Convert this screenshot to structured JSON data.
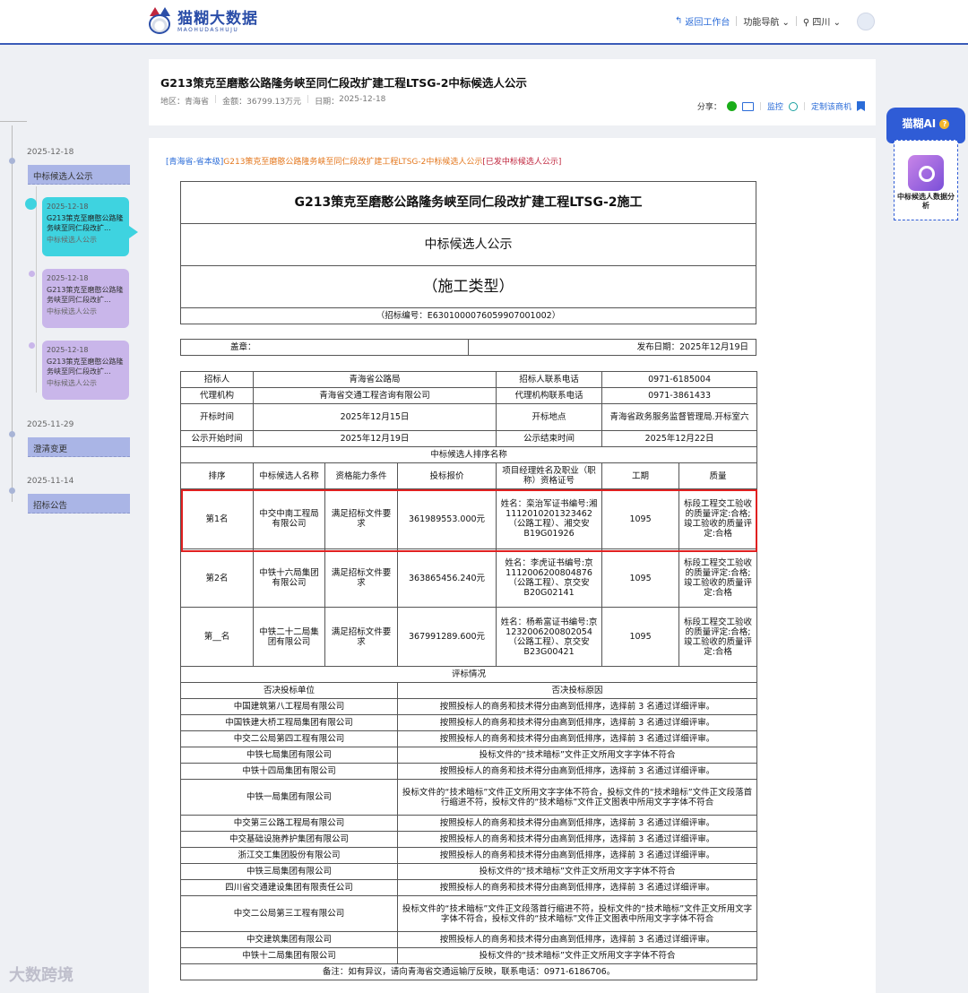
{
  "brand": {
    "name_cn": "猫糊大数据",
    "name_en": "MAOHUDASHUJU"
  },
  "nav": {
    "back": "返回工作台",
    "func_nav": "功能导航",
    "region": "四川"
  },
  "header": {
    "title": "G213策克至磨憨公路隆务峡至同仁段改扩建工程LTSG-2中标候选人公示",
    "region_label": "地区：",
    "region": "青海省",
    "amount_label": "金额：",
    "amount": "36799.13万元",
    "date_label": "日期：",
    "date": "2025-12-18",
    "share": "分享：",
    "monitor": "监控",
    "subscribe": "定制该商机"
  },
  "timeline": {
    "d1": "2025-12-18",
    "t1": "中标候选人公示",
    "c1_date": "2025-12-18",
    "c1_title": "G213策克至磨憨公路隆务峡至同仁段改扩...",
    "c1_type": "中标候选人公示",
    "c2_date": "2025-12-18",
    "c2_title": "G213策克至磨憨公路隆务峡至同仁段改扩...",
    "c2_type": "中标候选人公示",
    "c3_date": "2025-12-18",
    "c3_title": "G213策克至磨憨公路隆务峡至同仁段改扩...",
    "c3_type": "中标候选人公示",
    "d2": "2025-11-29",
    "t2": "澄清变更",
    "d3": "2025-11-14",
    "t3": "招标公告"
  },
  "doc": {
    "src_prefix": "[青海省-省本级]",
    "src_title": "G213策克至磨憨公路隆务峡至同仁段改扩建工程LTSG-2中标候选人公示",
    "src_suffix": "[已发中标候选人公示]",
    "h1": "G213策克至磨憨公路隆务峡至同仁段改扩建工程LTSG-2施工",
    "h2": "中标候选人公示",
    "h3": "（施工类型）",
    "code": "（招标编号：E6301000076059907001002）",
    "seal": "盖章：",
    "publish": "发布日期：2025年12月19日"
  },
  "info": {
    "tenderer_l": "招标人",
    "tenderer": "青海省公路局",
    "tenderer_tel_l": "招标人联系电话",
    "tenderer_tel": "0971-6185004",
    "agent_l": "代理机构",
    "agent": "青海省交通工程咨询有限公司",
    "agent_tel_l": "代理机构联系电话",
    "agent_tel": "0971-3861433",
    "open_time_l": "开标时间",
    "open_time": "2025年12月15日",
    "open_place_l": "开标地点",
    "open_place": "青海省政务服务监督管理局.开标室六",
    "pub_start_l": "公示开始时间",
    "pub_start": "2025年12月19日",
    "pub_end_l": "公示结束时间",
    "pub_end": "2025年12月22日"
  },
  "rank": {
    "section": "中标候选人排序名称",
    "headers": [
      "排序",
      "中标候选人名称",
      "资格能力条件",
      "投标报价",
      "项目经理姓名及职业（职称）资格证号",
      "工期",
      "质量"
    ],
    "rows": [
      {
        "rank": "第1名",
        "name": "中交中南工程局有限公司",
        "cond": "满足招标文件要求",
        "price": "361989553.000元",
        "pm": "姓名：栾治军证书编号:湘1112010201323462（公路工程）、湘交安B19G01926",
        "period": "1095",
        "quality": "标段工程交工验收的质量评定:合格; 竣工验收的质量评定:合格"
      },
      {
        "rank": "第2名",
        "name": "中铁十六局集团有限公司",
        "cond": "满足招标文件要求",
        "price": "363865456.240元",
        "pm": "姓名：李虎证书编号:京1112006200804876（公路工程）、京交安B20G02141",
        "period": "1095",
        "quality": "标段工程交工验收的质量评定:合格; 竣工验收的质量评定:合格"
      },
      {
        "rank": "第__名",
        "name": "中铁二十二局集团有限公司",
        "cond": "满足招标文件要求",
        "price": "367991289.600元",
        "pm": "姓名：杨希富证书编号:京1232006200802054（公路工程）、京交安B23G00421",
        "period": "1095",
        "quality": "标段工程交工验收的质量评定:合格; 竣工验收的质量评定:合格"
      }
    ]
  },
  "review": {
    "section": "评标情况",
    "col1": "否决投标单位",
    "col2": "否决投标原因",
    "rows": [
      {
        "unit": "中国建筑第八工程局有限公司",
        "reason": "按照投标人的商务和技术得分由高到低排序，选择前 3 名通过详细评审。"
      },
      {
        "unit": "中国铁建大桥工程局集团有限公司",
        "reason": "按照投标人的商务和技术得分由高到低排序，选择前 3 名通过详细评审。"
      },
      {
        "unit": "中交二公局第四工程有限公司",
        "reason": "按照投标人的商务和技术得分由高到低排序，选择前 3 名通过详细评审。"
      },
      {
        "unit": "中铁七局集团有限公司",
        "reason": "投标文件的“技术暗标”文件正文所用文字字体不符合"
      },
      {
        "unit": "中铁十四局集团有限公司",
        "reason": "按照投标人的商务和技术得分由高到低排序，选择前 3 名通过详细评审。"
      },
      {
        "unit": "中铁一局集团有限公司",
        "reason": "投标文件的“技术暗标”文件正文所用文字字体不符合，投标文件的“技术暗标”文件正文段落首行缩进不符，投标文件的“技术暗标”文件正文图表中所用文字字体不符合"
      },
      {
        "unit": "中交第三公路工程局有限公司",
        "reason": "按照投标人的商务和技术得分由高到低排序，选择前 3 名通过详细评审。"
      },
      {
        "unit": "中交基础设施养护集团有限公司",
        "reason": "按照投标人的商务和技术得分由高到低排序，选择前 3 名通过详细评审。"
      },
      {
        "unit": "浙江交工集团股份有限公司",
        "reason": "按照投标人的商务和技术得分由高到低排序，选择前 3 名通过详细评审。"
      },
      {
        "unit": "中铁三局集团有限公司",
        "reason": "投标文件的“技术暗标”文件正文所用文字字体不符合"
      },
      {
        "unit": "四川省交通建设集团有限责任公司",
        "reason": "按照投标人的商务和技术得分由高到低排序，选择前 3 名通过详细评审。"
      },
      {
        "unit": "中交二公局第三工程有限公司",
        "reason": "投标文件的“技术暗标”文件正文段落首行缩进不符，投标文件的“技术暗标”文件正文所用文字字体不符合，投标文件的“技术暗标”文件正文图表中所用文字字体不符合"
      },
      {
        "unit": "中交建筑集团有限公司",
        "reason": "按照投标人的商务和技术得分由高到低排序，选择前 3 名通过详细评审。"
      },
      {
        "unit": "中铁十二局集团有限公司",
        "reason": "投标文件的“技术暗标”文件正文所用文字字体不符合"
      }
    ],
    "note": "备注：如有异议，请向青海省交通运输厅反映，联系电话：0971-6186706。"
  },
  "ai": {
    "title": "猫糊AI",
    "help": "?",
    "feature": "中标候选人数据分析"
  },
  "watermark": "大数跨境"
}
